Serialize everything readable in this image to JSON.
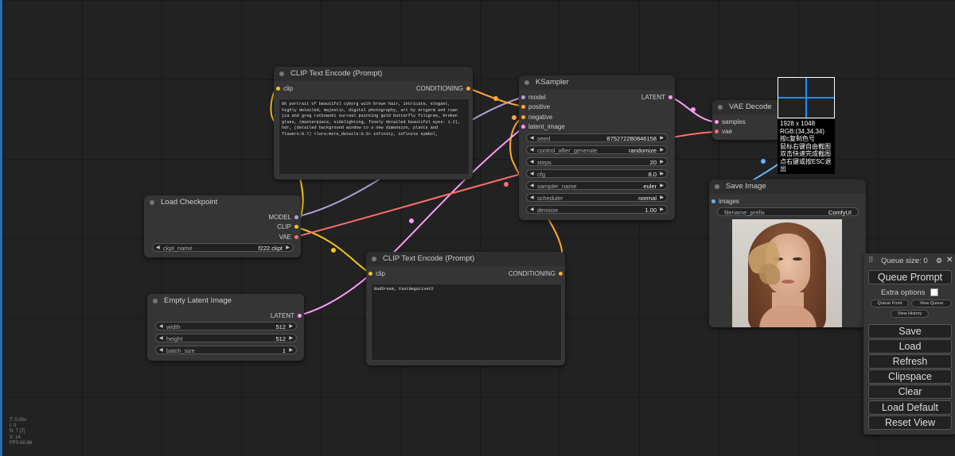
{
  "clip_text_pos": {
    "title": "CLIP Text Encode (Prompt)",
    "input": "clip",
    "output": "CONDITIONING",
    "text": "8k portrait of beautiful cyborg with brown hair, intricate, elegant, highly detailed, majestic, digital photography, art by artgerm and ruan jia and greg rutkowski surreal painting gold butterfly filigree, broken glass, (masterpiece, sidelighting, finely detailed beautiful eyes: 1.2), hdr, (detailed background window to a new dimension, plants and flowers:0.7) <lora:more_details:0.5> infinity, infinite symbol,"
  },
  "load_checkpoint": {
    "title": "Load Checkpoint",
    "outputs": [
      "MODEL",
      "CLIP",
      "VAE"
    ],
    "ckpt_label": "ckpt_name",
    "ckpt_value": "f222.ckpt"
  },
  "empty_latent": {
    "title": "Empty Latent Image",
    "output": "LATENT",
    "widgets": [
      {
        "label": "width",
        "value": "512"
      },
      {
        "label": "height",
        "value": "512"
      },
      {
        "label": "batch_size",
        "value": "1"
      }
    ]
  },
  "clip_text_neg": {
    "title": "CLIP Text Encode (Prompt)",
    "input": "clip",
    "output": "CONDITIONING",
    "text": "BadDream, FastNegativeV2"
  },
  "ksampler": {
    "title": "KSampler",
    "inputs": [
      "model",
      "positive",
      "negative",
      "latent_image"
    ],
    "output": "LATENT",
    "widgets": [
      {
        "label": "seed",
        "value": "875272280846158"
      },
      {
        "label": "control_after_generate",
        "value": "randomize"
      },
      {
        "label": "steps",
        "value": "20"
      },
      {
        "label": "cfg",
        "value": "8.0"
      },
      {
        "label": "sampler_name",
        "value": "euler"
      },
      {
        "label": "scheduler",
        "value": "normal"
      },
      {
        "label": "denoise",
        "value": "1.00"
      }
    ]
  },
  "vae_decode": {
    "title": "VAE Decode",
    "inputs": [
      "samples",
      "vae"
    ]
  },
  "save_image": {
    "title": "Save Image",
    "input": "images",
    "prefix_label": "filename_prefix",
    "prefix_value": "ComfyUI"
  },
  "tooltip": {
    "lines": [
      "1928 x 1048",
      "RGB:(34,34,34)",
      "按c复制色号",
      "鼠标右键自由截图",
      "双击快速完成截图",
      "点右键或按ESC退出"
    ]
  },
  "menu": {
    "queue_size": "Queue size: 0",
    "queue_prompt": "Queue Prompt",
    "extra_options": "Extra options",
    "queue_front": "Queue Front",
    "view_queue": "View Queue",
    "view_history": "View History",
    "buttons": [
      "Save",
      "Load",
      "Refresh",
      "Clipspace",
      "Clear",
      "Load Default",
      "Reset View"
    ]
  },
  "stats": [
    "T: 0.00s",
    "I: 0",
    "N: 7 [7]",
    "V: 14",
    "FPS:60.86"
  ],
  "colors": {
    "clip": "#f5c518",
    "model": "#b39ddb",
    "conditioning": "#ffa931",
    "latent": "#ff9cf9",
    "vae": "#ff6e6e",
    "image": "#64b5f6"
  },
  "icons": [
    "gear-icon",
    "close-icon",
    "drag-handle-icon"
  ]
}
